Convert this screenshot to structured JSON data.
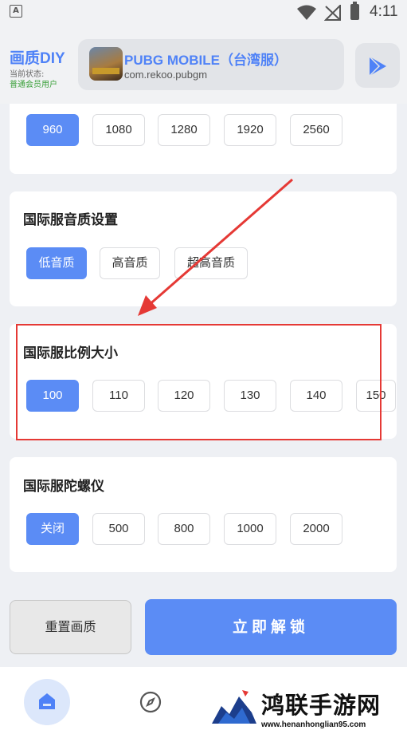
{
  "status_bar": {
    "left_icon": "A",
    "time": "4:11",
    "icons": [
      "wifi-icon",
      "no-signal-icon",
      "battery-icon"
    ]
  },
  "header": {
    "brand": "画质DIY",
    "status_label": "当前状态:",
    "member_label": "普通会员用户",
    "game_name": "PUBG MOBILE（台湾服）",
    "game_package": "com.rekoo.pubgm",
    "play_icon": "play-store-icon"
  },
  "resolution": {
    "options": [
      "960",
      "1080",
      "1280",
      "1920",
      "2560"
    ],
    "selected": "960"
  },
  "audio": {
    "title": "国际服音质设置",
    "options": [
      "低音质",
      "高音质",
      "超高音质"
    ],
    "selected": "低音质"
  },
  "scale": {
    "title": "国际服比例大小",
    "options": [
      "100",
      "110",
      "120",
      "130",
      "140",
      "150"
    ],
    "selected": "100"
  },
  "gyro": {
    "title": "国际服陀螺仪",
    "options": [
      "关闭",
      "500",
      "800",
      "1000",
      "2000"
    ],
    "selected": "关闭"
  },
  "actions": {
    "reset": "重置画质",
    "unlock": "立即解锁"
  },
  "nav": {
    "items": [
      "home-icon",
      "compass-icon"
    ]
  },
  "watermark": {
    "text": "鸿联手游网",
    "url": "www.henanhonglian95.com"
  },
  "colors": {
    "accent": "#5b8cf5",
    "brand": "#4f82f7",
    "highlight": "#e53935"
  }
}
